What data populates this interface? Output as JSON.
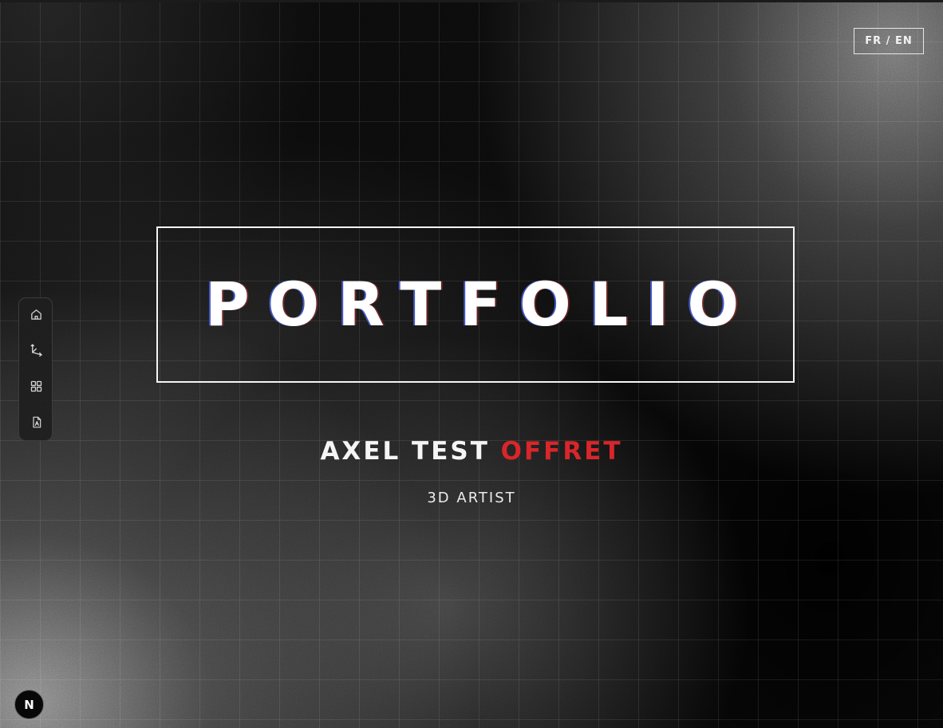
{
  "header": {
    "language_toggle_label": "FR / EN"
  },
  "sidebar": {
    "items": [
      {
        "icon": "home-icon"
      },
      {
        "icon": "axes-icon"
      },
      {
        "icon": "grid-icon"
      },
      {
        "icon": "resume-document-icon"
      }
    ]
  },
  "hero": {
    "title": "PORTFOLIO",
    "name_first": "AXEL TEST",
    "name_last": "OFFRET",
    "role": "3D ARTIST"
  },
  "badge": {
    "icon": "n-logo-icon",
    "letter": "N"
  },
  "colors": {
    "accent": "#d8262a",
    "text": "#f5f5f5",
    "background": "#050505"
  }
}
